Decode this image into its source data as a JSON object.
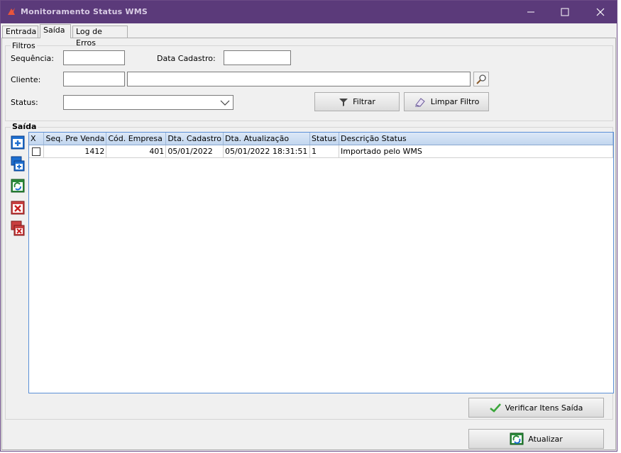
{
  "window": {
    "title": "Monitoramento Status WMS"
  },
  "tabs": [
    {
      "label": "Entrada"
    },
    {
      "label": "Saída"
    },
    {
      "label": "Log de Erros"
    }
  ],
  "filters": {
    "group_title": "Filtros",
    "sequencia_label": "Sequência:",
    "data_cadastro_label": "Data Cadastro:",
    "cliente_label": "Cliente:",
    "status_label": "Status:",
    "sequencia_value": "",
    "data_cadastro_value": "",
    "cliente_code_value": "",
    "cliente_name_value": "",
    "status_value": "",
    "filtrar_label": "Filtrar",
    "limpar_label": "Limpar Filtro"
  },
  "saida": {
    "group_title": "Saída",
    "columns": [
      "X",
      "Seq. Pre Venda",
      "Cód. Empresa",
      "Dta. Cadastro",
      "Dta. Atualização",
      "Status",
      "Descrição Status"
    ],
    "rows": [
      {
        "seq": "1412",
        "empresa": "401",
        "cadastro": "05/01/2022",
        "atualizacao": "05/01/2022 18:31:51",
        "status": "1",
        "descricao": "Importado pelo WMS"
      }
    ]
  },
  "actions": {
    "verificar_label": "Verificar Itens Saída",
    "atualizar_label": "Atualizar"
  },
  "colors": {
    "titlebar": "#5b3a7a",
    "grid_header": "#c2d6ef",
    "accent_blue": "#1e6fd0"
  }
}
